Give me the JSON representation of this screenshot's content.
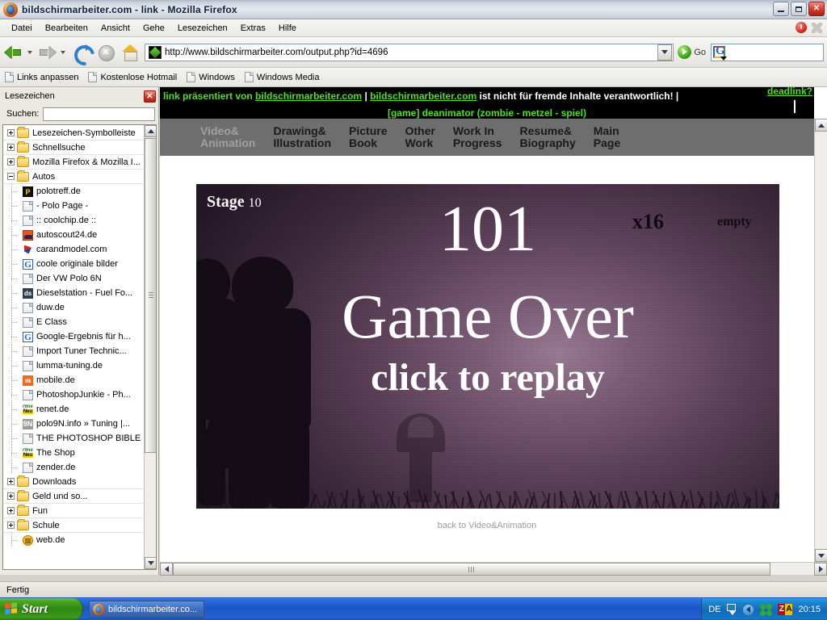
{
  "window": {
    "title": "bildschirmarbeiter.com - link - Mozilla Firefox",
    "minimize_label": "_",
    "maximize_label": "□",
    "close_label": "✕"
  },
  "menubar": {
    "items": [
      "Datei",
      "Bearbeiten",
      "Ansicht",
      "Gehe",
      "Lesezeichen",
      "Extras",
      "Hilfe"
    ]
  },
  "toolbar": {
    "back_title": "Zurück",
    "forward_title": "Vor",
    "reload_title": "Neu laden",
    "stop_title": "Stopp",
    "home_title": "Startseite",
    "url": "http://www.bildschirmarbeiter.com/output.php?id=4696",
    "go_label": "Go",
    "search_value": ""
  },
  "bookmarks_toolbar": {
    "items": [
      "Links anpassen",
      "Kostenlose Hotmail",
      "Windows",
      "Windows Media"
    ]
  },
  "sidebar": {
    "title": "Lesezeichen",
    "close_label": "✕",
    "search_label": "Suchen:",
    "search_value": "",
    "tree": [
      {
        "label": "Lesezeichen-Symbolleiste",
        "type": "folder",
        "state": "collapsed",
        "depth": 0
      },
      {
        "label": "Schnellsuche",
        "type": "folder",
        "state": "collapsed",
        "depth": 0
      },
      {
        "label": "Mozilla Firefox & Mozilla I...",
        "type": "folder",
        "state": "collapsed",
        "depth": 0
      },
      {
        "label": "Autos",
        "type": "folder",
        "state": "expanded",
        "depth": 0
      },
      {
        "label": "polotreff.de",
        "type": "bookmark",
        "icon": "polo",
        "depth": 1
      },
      {
        "label": "- Polo Page -",
        "type": "bookmark",
        "icon": "page",
        "depth": 1
      },
      {
        "label": ":: coolchip.de ::",
        "type": "bookmark",
        "icon": "page",
        "depth": 1
      },
      {
        "label": "autoscout24.de",
        "type": "bookmark",
        "icon": "scout",
        "depth": 1
      },
      {
        "label": "carandmodel.com",
        "type": "bookmark",
        "icon": "carmodel",
        "depth": 1
      },
      {
        "label": "coole originale bilder",
        "type": "bookmark",
        "icon": "goog",
        "depth": 1
      },
      {
        "label": "Der VW Polo 6N",
        "type": "bookmark",
        "icon": "page",
        "depth": 1
      },
      {
        "label": "Dieselstation - Fuel Fo...",
        "type": "bookmark",
        "icon": "ds",
        "depth": 1
      },
      {
        "label": "duw.de",
        "type": "bookmark",
        "icon": "page",
        "depth": 1
      },
      {
        "label": "E Class",
        "type": "bookmark",
        "icon": "page",
        "depth": 1
      },
      {
        "label": "Google-Ergebnis für h...",
        "type": "bookmark",
        "icon": "goog",
        "depth": 1
      },
      {
        "label": "Import Tuner Technic...",
        "type": "bookmark",
        "icon": "page",
        "depth": 1
      },
      {
        "label": "lumma-tuning.de",
        "type": "bookmark",
        "icon": "page",
        "depth": 1
      },
      {
        "label": "mobile.de",
        "type": "bookmark",
        "icon": "mobile",
        "depth": 1
      },
      {
        "label": "PhotoshopJunkie - Ph...",
        "type": "bookmark",
        "icon": "page",
        "depth": 1
      },
      {
        "label": "renet.de",
        "type": "bookmark",
        "icon": "renet",
        "depth": 1
      },
      {
        "label": "polo9N.info » Tuning |...",
        "type": "bookmark",
        "icon": "p9n",
        "depth": 1
      },
      {
        "label": "THE PHOTOSHOP BIBLE",
        "type": "bookmark",
        "icon": "page",
        "depth": 1
      },
      {
        "label": "The Shop",
        "type": "bookmark",
        "icon": "renet",
        "depth": 1
      },
      {
        "label": "zender.de",
        "type": "bookmark",
        "icon": "page",
        "depth": 1
      },
      {
        "label": "Downloads",
        "type": "folder",
        "state": "collapsed",
        "depth": 0
      },
      {
        "label": "Geld und so...",
        "type": "folder",
        "state": "collapsed",
        "depth": 0
      },
      {
        "label": "Fun",
        "type": "folder",
        "state": "collapsed",
        "depth": 0
      },
      {
        "label": "Schule",
        "type": "folder",
        "state": "collapsed",
        "depth": 0
      },
      {
        "label": "web.de",
        "type": "bookmark",
        "icon": "webde",
        "depth": 1
      }
    ]
  },
  "page": {
    "banner": {
      "prefix": "link präsentiert von",
      "link1": "bildschirmarbeiter.com",
      "separator1": "|",
      "link2": "bildschirmarbeiter.com",
      "disclaimer": "ist nicht für fremde Inhalte verantwortlich!",
      "separator2": "|",
      "deadlink": "deadlink?",
      "subtitle": "[game] deanimator (zombie - metzel - spiel)"
    },
    "nav": [
      {
        "label": "Video&\nAnimation",
        "active": true
      },
      {
        "label": "Drawing&\nIllustration",
        "active": false
      },
      {
        "label": "Picture\nBook",
        "active": false
      },
      {
        "label": "Other\nWork",
        "active": false
      },
      {
        "label": "Work In\nProgress",
        "active": false
      },
      {
        "label": "Resume&\nBiography",
        "active": false
      },
      {
        "label": "Main\nPage",
        "active": false
      }
    ],
    "game": {
      "stage_label": "Stage",
      "stage_number": "10",
      "score": "101",
      "multiplier": "x16",
      "ammo": "empty",
      "game_over": "Game Over",
      "replay": "click to replay",
      "bg_color": "#5d4159"
    },
    "back_link": "back to Video&Animation"
  },
  "statusbar": {
    "text": "Fertig"
  },
  "taskbar": {
    "start_label": "Start",
    "window_button": "bildschirmarbeiter.co...",
    "tray": {
      "language": "DE",
      "clock": "20:15",
      "za_left": "Z",
      "za_right": "A"
    }
  }
}
